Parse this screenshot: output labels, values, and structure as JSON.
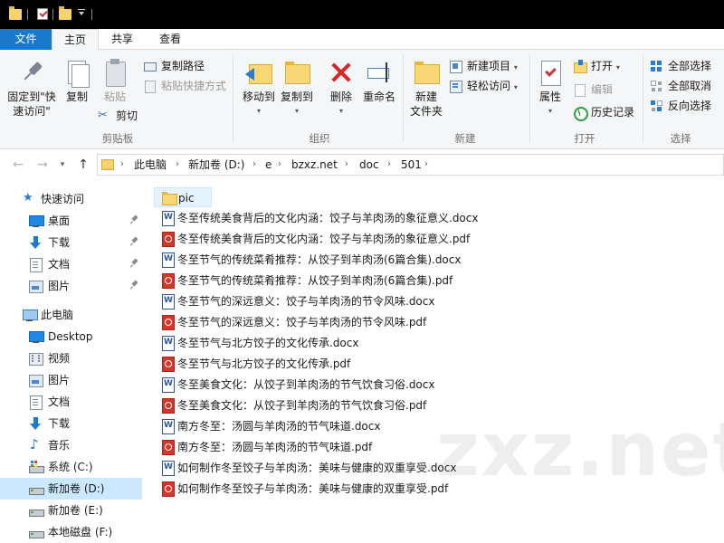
{
  "titlebar": {
    "quick_access": [
      "folder-icon",
      "properties-icon",
      "new-folder-icon",
      "customize-arrow-icon"
    ]
  },
  "tabs": [
    {
      "label": "文件"
    },
    {
      "label": "主页"
    },
    {
      "label": "共享"
    },
    {
      "label": "查看"
    }
  ],
  "ribbon": {
    "groups": {
      "clipboard": "剪贴板",
      "organize": "组织",
      "new": "新建",
      "open": "打开",
      "select": "选择"
    },
    "pin_quick_access": "固定到\"快\n速访问\"",
    "pin_line1": "固定到\"快",
    "pin_line2": "速访问\"",
    "copy": "复制",
    "paste": "粘贴",
    "copy_path": "复制路径",
    "paste_shortcut": "粘贴快捷方式",
    "cut": "剪切",
    "move_to": "移动到",
    "copy_to": "复制到",
    "delete": "删除",
    "rename": "重命名",
    "new_folder_line1": "新建",
    "new_folder_line2": "文件夹",
    "new_item": "新建项目",
    "easy_access": "轻松访问",
    "properties": "属性",
    "open": "打开",
    "edit": "编辑",
    "history": "历史记录",
    "select_all": "全部选择",
    "select_none": "全部取消",
    "invert_selection": "反向选择"
  },
  "address": {
    "crumbs": [
      "此电脑",
      "新加卷 (D:)",
      "e",
      "bzxz.net",
      "doc",
      "501"
    ]
  },
  "navpane": {
    "items": [
      {
        "label": "快速访问",
        "icon": "star-icon",
        "pinned": false
      },
      {
        "label": "桌面",
        "icon": "desktop-icon",
        "pinned": true
      },
      {
        "label": "下载",
        "icon": "download-icon",
        "pinned": true
      },
      {
        "label": "文档",
        "icon": "documents-icon",
        "pinned": true
      },
      {
        "label": "图片",
        "icon": "pictures-icon",
        "pinned": true
      },
      {
        "label": "此电脑",
        "icon": "this-pc-icon",
        "pinned": false
      },
      {
        "label": "Desktop",
        "icon": "desktop-icon",
        "pinned": false
      },
      {
        "label": "视频",
        "icon": "videos-icon",
        "pinned": false
      },
      {
        "label": "图片",
        "icon": "pictures-icon",
        "pinned": false
      },
      {
        "label": "文档",
        "icon": "documents-icon",
        "pinned": false
      },
      {
        "label": "下载",
        "icon": "download-icon",
        "pinned": false
      },
      {
        "label": "音乐",
        "icon": "music-icon",
        "pinned": false
      },
      {
        "label": "系统 (C:)",
        "icon": "system-drive-icon",
        "pinned": false
      },
      {
        "label": "新加卷 (D:)",
        "icon": "drive-icon",
        "pinned": false,
        "selected": true
      },
      {
        "label": "新加卷 (E:)",
        "icon": "drive-icon",
        "pinned": false
      },
      {
        "label": "本地磁盘 (F:)",
        "icon": "drive-icon",
        "pinned": false
      }
    ]
  },
  "files": [
    {
      "name": "pic",
      "type": "folder"
    },
    {
      "name": "冬至传统美食背后的文化内涵：饺子与羊肉汤的象征意义.docx",
      "type": "docx"
    },
    {
      "name": "冬至传统美食背后的文化内涵：饺子与羊肉汤的象征意义.pdf",
      "type": "pdf"
    },
    {
      "name": "冬至节气的传统菜肴推荐：从饺子到羊肉汤(6篇合集).docx",
      "type": "docx"
    },
    {
      "name": "冬至节气的传统菜肴推荐：从饺子到羊肉汤(6篇合集).pdf",
      "type": "pdf"
    },
    {
      "name": "冬至节气的深远意义：饺子与羊肉汤的节令风味.docx",
      "type": "docx"
    },
    {
      "name": "冬至节气的深远意义：饺子与羊肉汤的节令风味.pdf",
      "type": "pdf"
    },
    {
      "name": "冬至节气与北方饺子的文化传承.docx",
      "type": "docx"
    },
    {
      "name": "冬至节气与北方饺子的文化传承.pdf",
      "type": "pdf"
    },
    {
      "name": "冬至美食文化：从饺子到羊肉汤的节气饮食习俗.docx",
      "type": "docx"
    },
    {
      "name": "冬至美食文化：从饺子到羊肉汤的节气饮食习俗.pdf",
      "type": "pdf"
    },
    {
      "name": "南方冬至：汤圆与羊肉汤的节气味道.docx",
      "type": "docx"
    },
    {
      "name": "南方冬至：汤圆与羊肉汤的节气味道.pdf",
      "type": "pdf"
    },
    {
      "name": "如何制作冬至饺子与羊肉汤：美味与健康的双重享受.docx",
      "type": "docx"
    },
    {
      "name": "如何制作冬至饺子与羊肉汤：美味与健康的双重享受.pdf",
      "type": "pdf"
    }
  ],
  "watermark": "zxz.net",
  "colors": {
    "accent": "#1979ca",
    "selection": "#cce8ff",
    "title_bar": "#000000",
    "pdf_red": "#d6352a",
    "docx_blue": "#2b5797",
    "folder_yellow": "#f8d775"
  }
}
